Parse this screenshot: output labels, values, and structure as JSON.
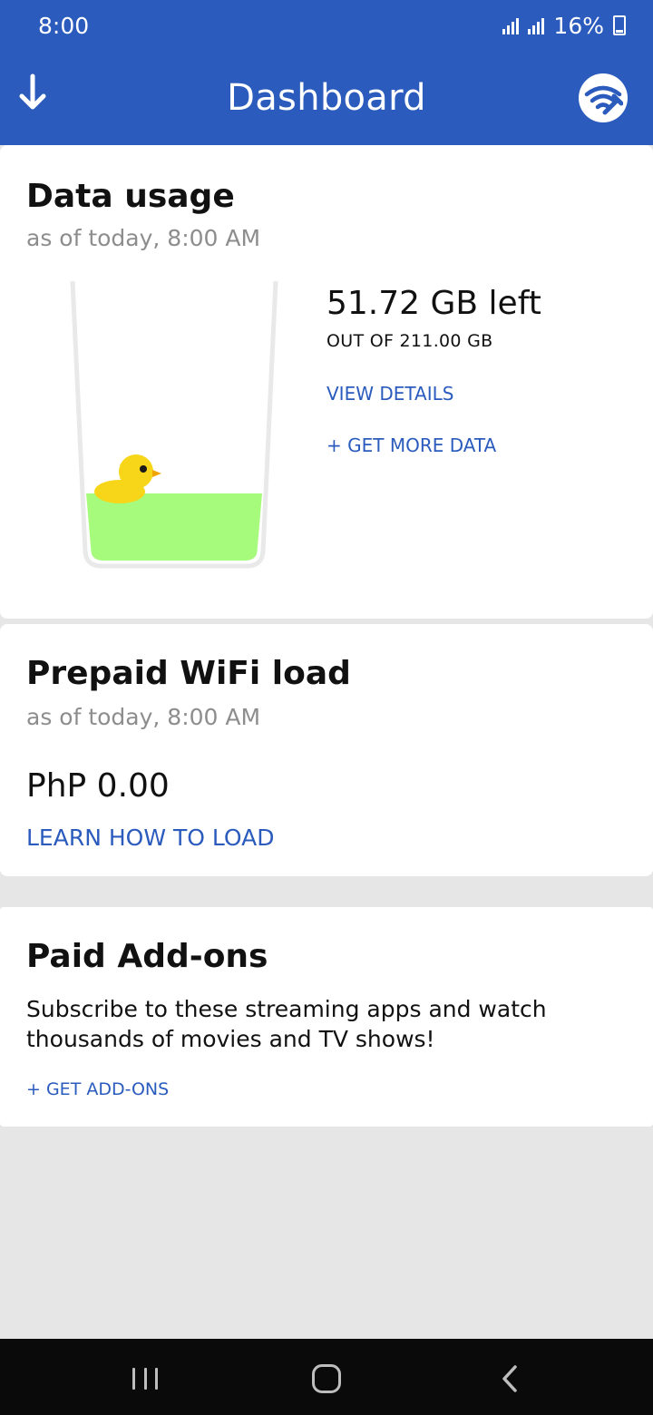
{
  "status_bar": {
    "time": "8:00",
    "battery": "16%"
  },
  "app_bar": {
    "title": "Dashboard",
    "back_icon": "arrow-down-icon",
    "wifi_icon": "wifi-tools-icon"
  },
  "data_usage": {
    "title": "Data usage",
    "as_of": "as of today, 8:00 AM",
    "remaining": "51.72 GB left",
    "total": "OUT OF 211.00 GB",
    "remaining_fraction": 0.245,
    "view_details_label": "VIEW DETAILS",
    "get_more_label": "+ GET MORE DATA",
    "fill_color": "#a7fb7c",
    "duck_color": "#f7d61a"
  },
  "wifi_load": {
    "title": "Prepaid WiFi load",
    "as_of": "as of today, 8:00 AM",
    "amount": "PhP 0.00",
    "learn_label": "LEARN HOW TO LOAD"
  },
  "addons": {
    "title": "Paid Add-ons",
    "description": "Subscribe to these streaming apps and watch thousands of movies and TV shows!",
    "get_label": "+ GET ADD-ONS"
  },
  "colors": {
    "brand": "#2a5bbd",
    "background": "#e6e6e6"
  },
  "nav_bar": {
    "recents_icon": "recents-icon",
    "home_icon": "home-icon",
    "back_icon": "back-chevron-icon"
  }
}
